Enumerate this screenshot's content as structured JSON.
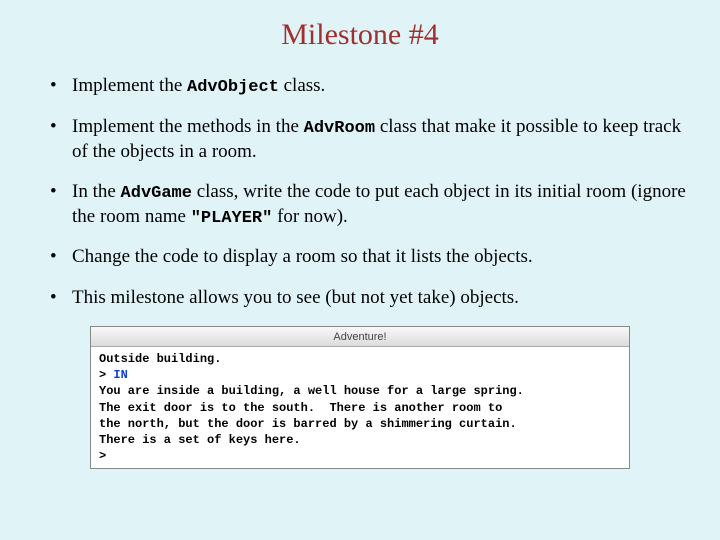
{
  "title": "Milestone #4",
  "bullets": {
    "b1_a": "Implement the ",
    "b1_code": "AdvObject",
    "b1_b": " class.",
    "b2_a": "Implement the methods in the ",
    "b2_code": "AdvRoom",
    "b2_b": " class that make it possible to keep track of the objects in a room.",
    "b3_a": "In the ",
    "b3_code1": "AdvGame",
    "b3_b": " class, write the code to put each object in its initial room (ignore the room name ",
    "b3_code2": "\"PLAYER\"",
    "b3_c": " for now).",
    "b4": "Change the code to display a room so that it lists the objects.",
    "b5": "This milestone allows you to see (but not yet take) objects."
  },
  "terminal": {
    "title": "Adventure!",
    "line1": "Outside building.",
    "prompt1": "> ",
    "cmd1": "IN",
    "line2": "You are inside a building, a well house for a large spring.",
    "line3": "The exit door is to the south.  There is another room to",
    "line4": "the north, but the door is barred by a shimmering curtain.",
    "line5": "There is a set of keys here.",
    "prompt2": ">"
  }
}
